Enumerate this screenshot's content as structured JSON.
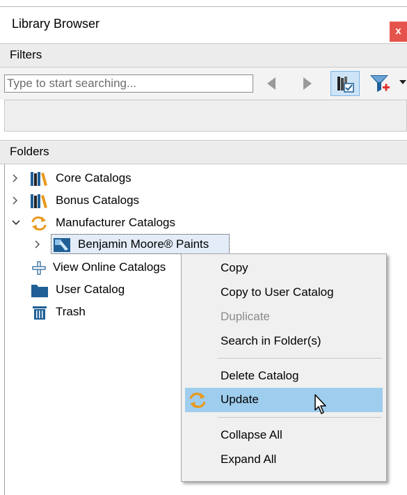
{
  "window": {
    "title": "Library Browser",
    "close_label": "x"
  },
  "filters": {
    "header": "Filters",
    "search_placeholder": "Type to start searching...",
    "icons": [
      "back-arrow-icon",
      "forward-arrow-icon",
      "catalog-toggle-icon",
      "filter-add-icon",
      "dropdown-arrow-icon"
    ]
  },
  "folders": {
    "header": "Folders",
    "items": [
      {
        "label": "Core Catalogs",
        "icon": "books-icon",
        "expander": "collapsed"
      },
      {
        "label": "Bonus Catalogs",
        "icon": "books-icon",
        "expander": "collapsed"
      },
      {
        "label": "Manufacturer Catalogs",
        "icon": "update-arrows-icon",
        "expander": "expanded"
      },
      {
        "label": "Benjamin Moore® Paints",
        "icon": "paint-catalog-icon",
        "expander": "collapsed",
        "selected": true
      },
      {
        "label": "View Online Catalogs",
        "icon": "plus-icon",
        "expander": "none"
      },
      {
        "label": "User Catalog",
        "icon": "folder-icon",
        "expander": "none"
      },
      {
        "label": "Trash",
        "icon": "trash-icon",
        "expander": "none"
      }
    ]
  },
  "context_menu": {
    "items": [
      {
        "label": "Copy",
        "enabled": true
      },
      {
        "label": "Copy to User Catalog",
        "enabled": true
      },
      {
        "label": "Duplicate",
        "enabled": false
      },
      {
        "label": "Search in Folder(s)",
        "enabled": true
      },
      {
        "label": "Delete Catalog",
        "enabled": true
      },
      {
        "label": "Update",
        "enabled": true,
        "highlighted": true,
        "icon": "update-arrows-icon"
      },
      {
        "label": "Collapse All",
        "enabled": true
      },
      {
        "label": "Expand All",
        "enabled": true
      }
    ]
  },
  "colors": {
    "close_button": "#e5544c",
    "menu_highlight": "#9fcdee",
    "section_header": "#ececec",
    "orange_icon": "#e89a1e",
    "blue_icon": "#1f5f96"
  }
}
